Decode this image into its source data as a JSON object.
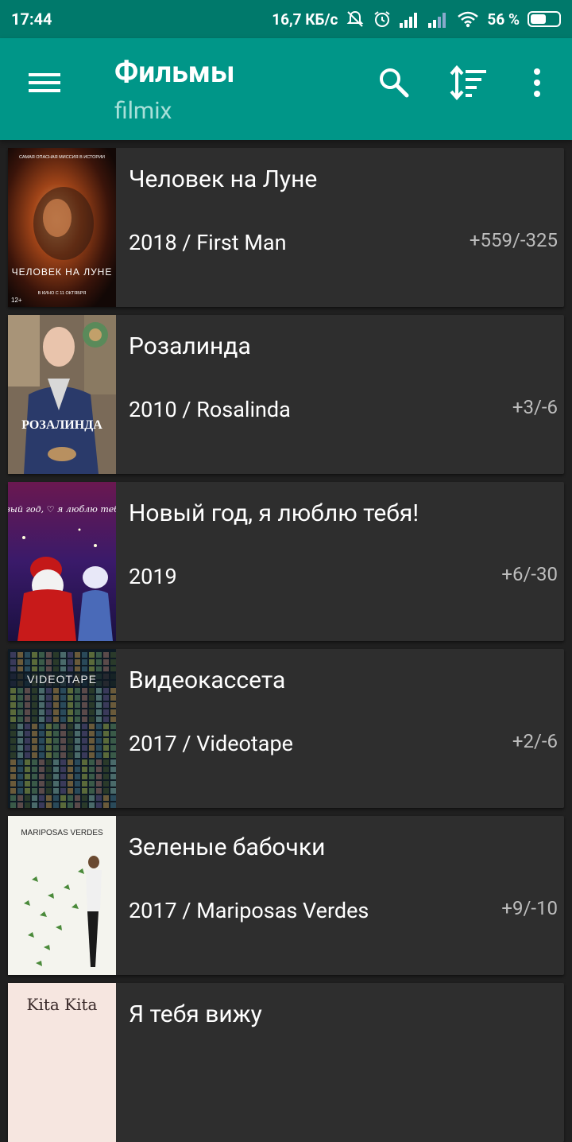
{
  "status_bar": {
    "time": "17:44",
    "speed": "16,7 КБ/с",
    "battery": "56 %",
    "battery_level": 0.56,
    "icons": [
      "mute-icon",
      "alarm-icon",
      "signal-icon",
      "signal-icon",
      "wifi-icon",
      "battery-icon"
    ]
  },
  "app_bar": {
    "title": "Фильмы",
    "subtitle": "filmix",
    "color": "#009688",
    "actions": [
      "menu-icon",
      "search-icon",
      "sort-icon",
      "more-vert-icon"
    ]
  },
  "movies": [
    {
      "title": "Человек на Луне",
      "subtitle": "2018 / First Man",
      "rating": "+559/-325",
      "poster": {
        "overlay": "ЧЕЛОВЕК НА ЛУНЕ",
        "top_line": "САМАЯ ОПАСНАЯ МИССИЯ В ИСТОРИИ",
        "bottom_line": "В КИНО С 11 ОКТЯБРЯ",
        "age": "12+"
      }
    },
    {
      "title": "Розалинда",
      "subtitle": "2010 / Rosalinda",
      "rating": "+3/-6",
      "poster": {
        "overlay": "РОЗАЛИНДА"
      }
    },
    {
      "title": "Новый год, я люблю тебя!",
      "subtitle": "2019",
      "rating": "+6/-30",
      "poster": {
        "overlay": "Новый год, ♡ я люблю тебя!"
      }
    },
    {
      "title": "Видеокассета",
      "subtitle": "2017 / Videotape",
      "rating": "+2/-6",
      "poster": {
        "overlay": "VIDEOTAPE"
      }
    },
    {
      "title": "Зеленые бабочки",
      "subtitle": "2017 / Mariposas Verdes",
      "rating": "+9/-10",
      "poster": {
        "overlay": "MARIPOSAS VERDES"
      }
    },
    {
      "title": "Я тебя вижу",
      "subtitle": "",
      "rating": "",
      "poster": {
        "overlay": "Kita Kita"
      }
    }
  ]
}
